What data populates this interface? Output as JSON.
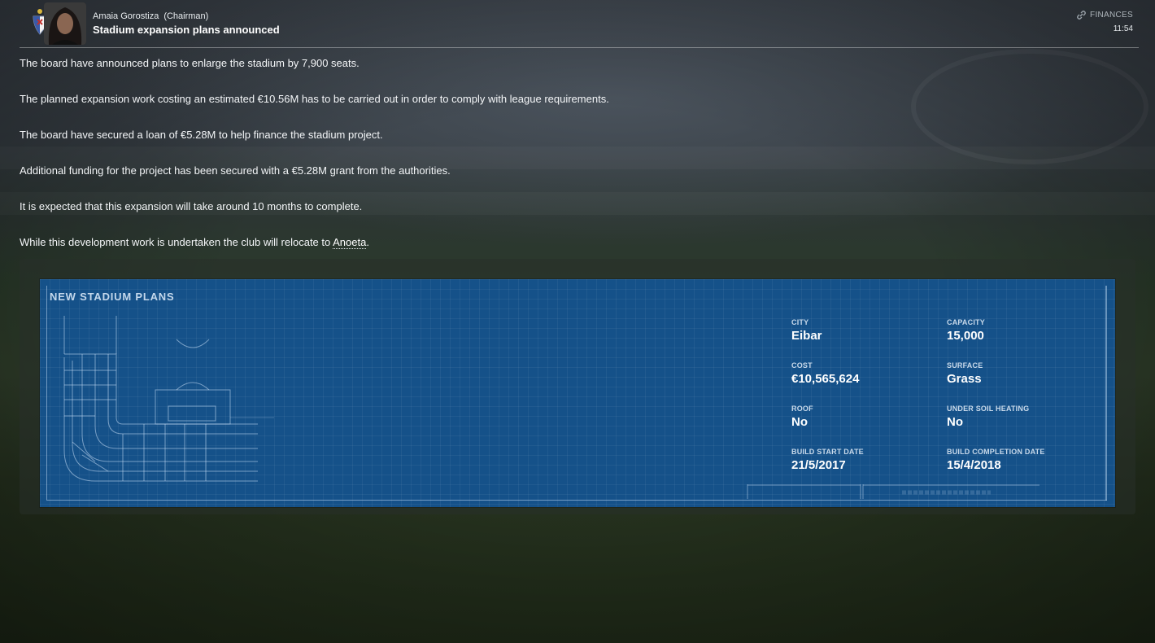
{
  "message": {
    "sender_name": "Amaia Gorostiza",
    "sender_role": "(Chairman)",
    "title": "Stadium expansion plans announced",
    "category": "FINANCES",
    "time": "11:54"
  },
  "paragraphs": {
    "p1": "The board have announced plans to enlarge the stadium by 7,900 seats.",
    "p2": "The planned expansion work costing an estimated €10.56M has to be carried out in order to comply with league requirements.",
    "p3": "The board have secured a loan of €5.28M to help finance the stadium project.",
    "p4": "Additional funding for the project has been secured with a €5.28M grant from the authorities.",
    "p5": "It is expected that this expansion will take around 10 months to complete.",
    "p6_prefix": "While this development work is undertaken the club will relocate to ",
    "p6_link": "Anoeta",
    "p6_suffix": "."
  },
  "plans": {
    "title": "NEW STADIUM PLANS",
    "city_label": "CITY",
    "city": "Eibar",
    "capacity_label": "CAPACITY",
    "capacity": "15,000",
    "cost_label": "COST",
    "cost": "€10,565,624",
    "surface_label": "SURFACE",
    "surface": "Grass",
    "roof_label": "ROOF",
    "roof": "No",
    "heating_label": "UNDER SOIL HEATING",
    "heating": "No",
    "start_label": "BUILD START DATE",
    "start": "21/5/2017",
    "completion_label": "BUILD COMPLETION DATE",
    "completion": "15/4/2018"
  },
  "icons": {
    "category_icon": "link-icon",
    "club_badge": "club-crest-icon"
  }
}
